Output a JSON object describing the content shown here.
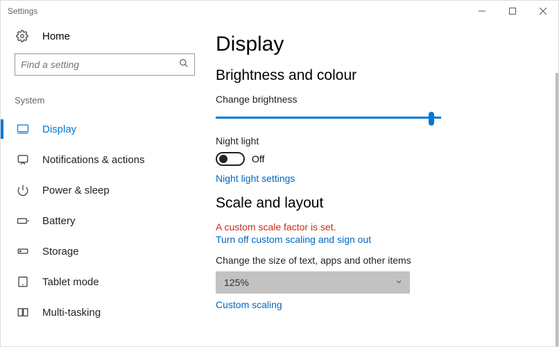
{
  "window": {
    "title": "Settings"
  },
  "sidebar": {
    "home": "Home",
    "search_placeholder": "Find a setting",
    "category": "System",
    "items": [
      {
        "label": "Display",
        "icon": "monitor-icon",
        "active": true
      },
      {
        "label": "Notifications & actions",
        "icon": "notifications-icon"
      },
      {
        "label": "Power & sleep",
        "icon": "power-icon"
      },
      {
        "label": "Battery",
        "icon": "battery-icon"
      },
      {
        "label": "Storage",
        "icon": "storage-icon"
      },
      {
        "label": "Tablet mode",
        "icon": "tablet-icon"
      },
      {
        "label": "Multi-tasking",
        "icon": "multitasking-icon"
      }
    ]
  },
  "main": {
    "title": "Display",
    "brightness": {
      "section": "Brightness and colour",
      "label": "Change brightness",
      "value_pct": 97
    },
    "nightlight": {
      "label": "Night light",
      "state": "Off",
      "link": "Night light settings"
    },
    "scale": {
      "section": "Scale and layout",
      "warning": "A custom scale factor is set.",
      "turnoff_link": "Turn off custom scaling and sign out",
      "size_label": "Change the size of text, apps and other items",
      "size_value": "125%",
      "custom_link": "Custom scaling"
    }
  }
}
